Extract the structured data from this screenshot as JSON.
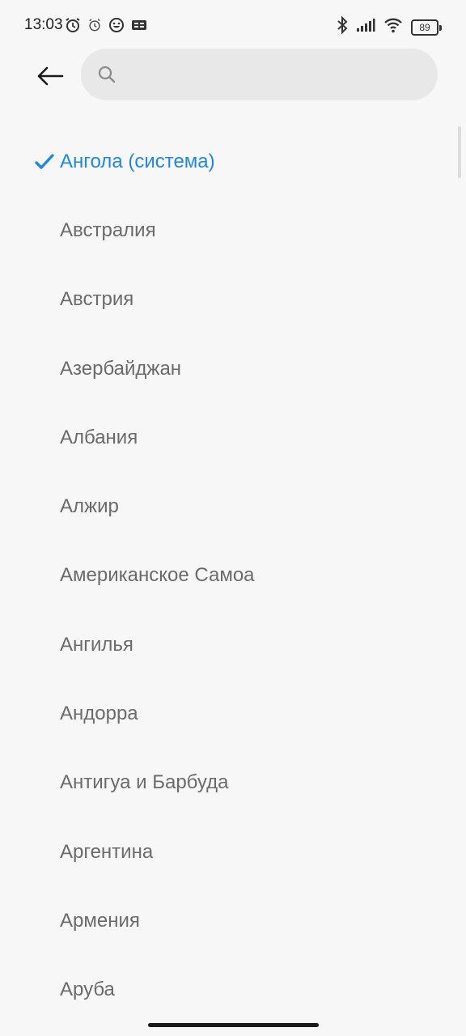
{
  "status_bar": {
    "time": "13:03",
    "battery": "89",
    "left_icons": [
      "alarm-clock-icon",
      "alarm-clock-outline-icon",
      "emoji-app-icon",
      "notification-box-icon"
    ],
    "right_icons": [
      "bluetooth-icon",
      "signal-icon",
      "wifi-icon",
      "battery-icon"
    ]
  },
  "header": {
    "back_icon": "arrow-left-icon",
    "search": {
      "icon": "search-icon",
      "value": "",
      "placeholder": ""
    }
  },
  "colors": {
    "accent": "#1e88e5",
    "text": "#6b6b6b",
    "background": "#f7f7f7",
    "search_bg": "#e8e8e8"
  },
  "countries": [
    {
      "label": "Ангола (система)",
      "selected": true
    },
    {
      "label": "Австралия",
      "selected": false
    },
    {
      "label": "Австрия",
      "selected": false
    },
    {
      "label": "Азербайджан",
      "selected": false
    },
    {
      "label": "Албания",
      "selected": false
    },
    {
      "label": "Алжир",
      "selected": false
    },
    {
      "label": "Американское Самоа",
      "selected": false
    },
    {
      "label": "Ангилья",
      "selected": false
    },
    {
      "label": "Андорра",
      "selected": false
    },
    {
      "label": "Антигуа и Барбуда",
      "selected": false
    },
    {
      "label": "Аргентина",
      "selected": false
    },
    {
      "label": "Армения",
      "selected": false
    },
    {
      "label": "Аруба",
      "selected": false
    }
  ]
}
